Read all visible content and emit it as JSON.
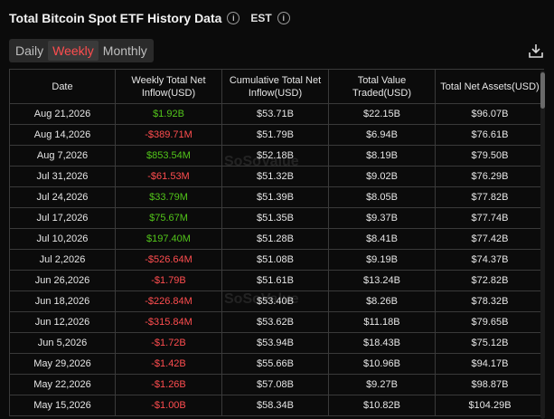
{
  "header": {
    "title": "Total Bitcoin Spot ETF History Data",
    "timezone": "EST"
  },
  "tabs": [
    {
      "label": "Daily"
    },
    {
      "label": "Weekly"
    },
    {
      "label": "Monthly"
    }
  ],
  "table": {
    "columns": [
      "Date",
      "Weekly Total Net Inflow(USD)",
      "Cumulative Total Net Inflow(USD)",
      "Total Value Traded(USD)",
      "Total Net Assets(USD)"
    ],
    "rows": [
      [
        "Aug 21,2026",
        "$1.92B",
        "$53.71B",
        "$22.15B",
        "$96.07B"
      ],
      [
        "Aug 14,2026",
        "-$389.71M",
        "$51.79B",
        "$6.94B",
        "$76.61B"
      ],
      [
        "Aug 7,2026",
        "$853.54M",
        "$52.18B",
        "$8.19B",
        "$79.50B"
      ],
      [
        "Jul 31,2026",
        "-$61.53M",
        "$51.32B",
        "$9.02B",
        "$76.29B"
      ],
      [
        "Jul 24,2026",
        "$33.79M",
        "$51.39B",
        "$8.05B",
        "$77.82B"
      ],
      [
        "Jul 17,2026",
        "$75.67M",
        "$51.35B",
        "$9.37B",
        "$77.74B"
      ],
      [
        "Jul 10,2026",
        "$197.40M",
        "$51.28B",
        "$8.41B",
        "$77.42B"
      ],
      [
        "Jul 2,2026",
        "-$526.64M",
        "$51.08B",
        "$9.19B",
        "$74.37B"
      ],
      [
        "Jun 26,2026",
        "-$1.79B",
        "$51.61B",
        "$13.24B",
        "$72.82B"
      ],
      [
        "Jun 18,2026",
        "-$226.84M",
        "$53.40B",
        "$8.26B",
        "$78.32B"
      ],
      [
        "Jun 12,2026",
        "-$315.84M",
        "$53.62B",
        "$11.18B",
        "$79.65B"
      ],
      [
        "Jun 5,2026",
        "-$1.72B",
        "$53.94B",
        "$18.43B",
        "$75.12B"
      ],
      [
        "May 29,2026",
        "-$1.42B",
        "$55.66B",
        "$10.96B",
        "$94.17B"
      ],
      [
        "May 22,2026",
        "-$1.26B",
        "$57.08B",
        "$9.27B",
        "$98.87B"
      ],
      [
        "May 15,2026",
        "-$1.00B",
        "$58.34B",
        "$10.82B",
        "$104.29B"
      ]
    ]
  },
  "watermark": "SoSoValue",
  "colors": {
    "positive": "#52c41a",
    "negative": "#ff4d4f",
    "active_tab": "#ff4d4f"
  },
  "icons": {
    "info": "info-circle-icon",
    "download": "download-icon"
  }
}
